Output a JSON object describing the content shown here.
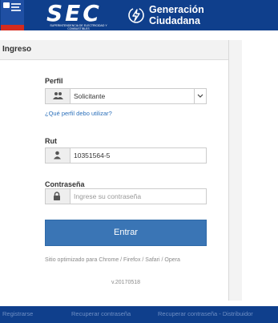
{
  "header": {
    "brand": "SEC",
    "brand_subtitle": "SUPERINTENDENCIA DE ELECTRICIDAD Y COMBUSTIBLES",
    "program_line1": "Generación",
    "program_line2": "Ciudadana"
  },
  "panel": {
    "title": "Ingreso"
  },
  "form": {
    "profile_label": "Perfil",
    "profile_selected": "Solicitante",
    "profile_help_link": "¿Qué perfil debo utilizar?",
    "rut_label": "Rut",
    "rut_value": "10351564-5",
    "password_label": "Contraseña",
    "password_placeholder": "Ingrese su contraseña",
    "submit_label": "Entrar",
    "browser_note": "Sitio optimizado para Chrome / Firefox / Safari / Opera",
    "version": "v.20170518"
  },
  "footer": {
    "links": [
      "Registrarse",
      "Recuperar contraseña",
      "Recuperar contraseña - Distribuidor"
    ]
  },
  "colors": {
    "header_bg": "#0f3f8c",
    "button_bg": "#3a75b5",
    "link": "#2a6fba"
  },
  "icons": {
    "profile": "users-icon",
    "rut": "user-icon",
    "password": "lock-icon"
  }
}
